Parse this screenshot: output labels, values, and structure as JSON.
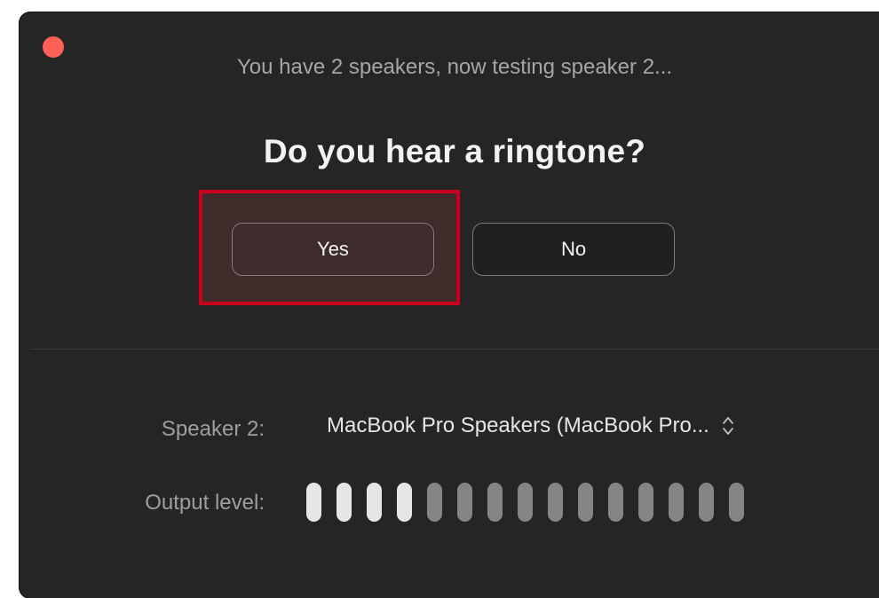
{
  "window": {
    "close_color": "#fe5f57"
  },
  "status": {
    "text": "You have 2 speakers, now testing speaker 2..."
  },
  "question": {
    "text": "Do you hear a ringtone?"
  },
  "buttons": {
    "yes_label": "Yes",
    "no_label": "No",
    "highlight_color": "#c8001b"
  },
  "speaker": {
    "label": "Speaker 2:",
    "selected": "MacBook Pro Speakers (MacBook Pro...",
    "icon": "chevron-up-down-icon"
  },
  "output": {
    "label": "Output level:",
    "total_segments": 15,
    "active_segments": 4
  }
}
